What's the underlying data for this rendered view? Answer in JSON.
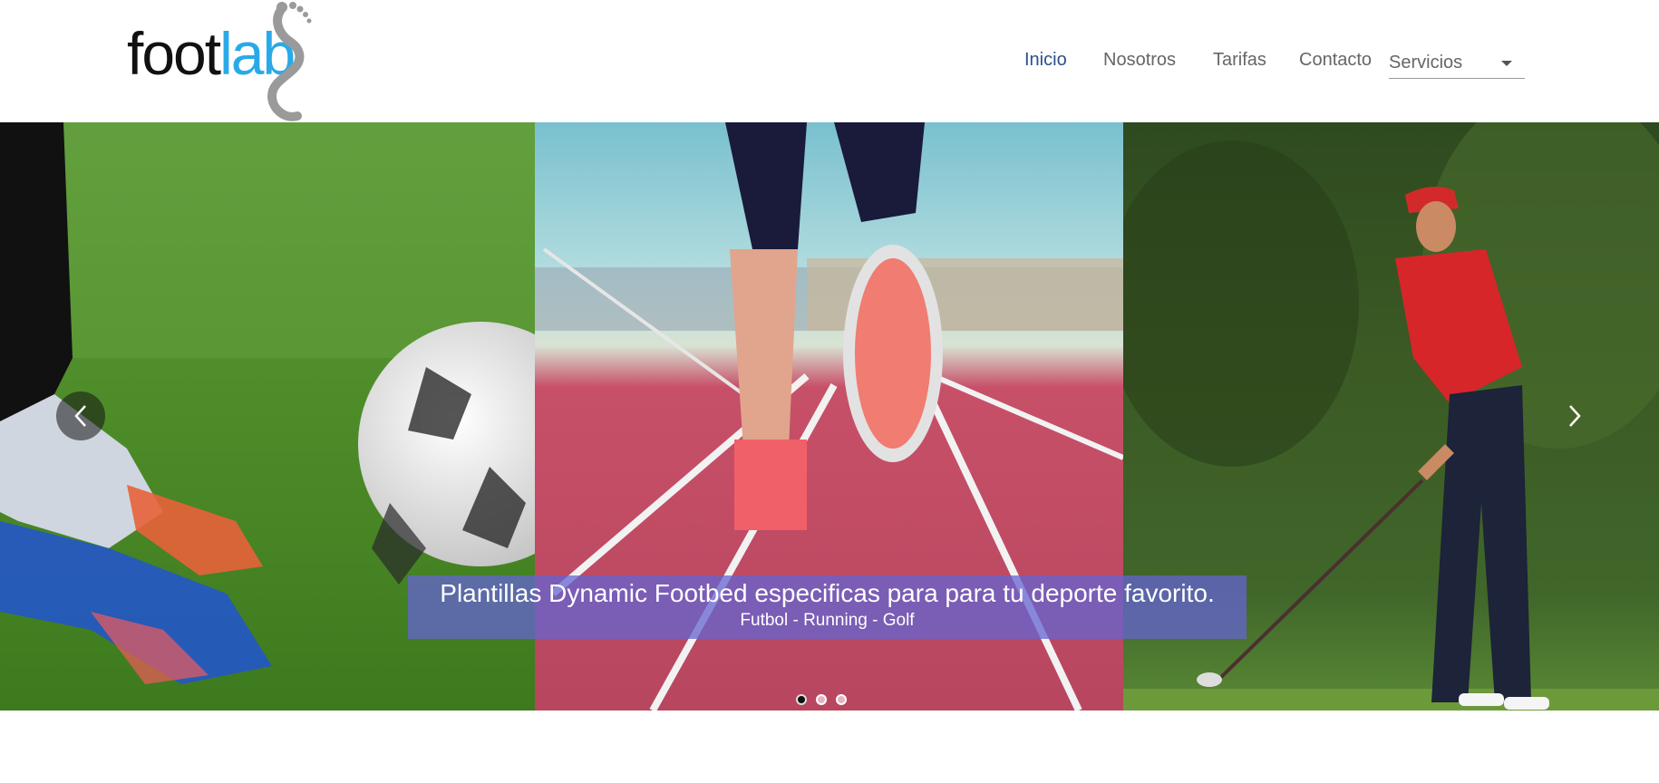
{
  "brand": {
    "logo_part1": "foot",
    "logo_part2": "lab"
  },
  "nav": {
    "items": [
      {
        "label": "Inicio",
        "active": true
      },
      {
        "label": "Nosotros",
        "active": false
      },
      {
        "label": "Tarifas",
        "active": false
      },
      {
        "label": "Contacto",
        "active": false
      }
    ],
    "services_select": {
      "value": "Servicios"
    }
  },
  "carousel": {
    "caption_title": "Plantillas Dynamic Footbed especificas para para tu deporte favorito.",
    "caption_subtitle": "Futbol - Running - Golf",
    "slides": [
      "soccer",
      "running",
      "golf"
    ],
    "active_index": 0,
    "slide_count": 3
  },
  "colors": {
    "accent": "#2c4f8a",
    "brand_blue": "#2aa9e8",
    "caption_bg": "#6464d2"
  }
}
